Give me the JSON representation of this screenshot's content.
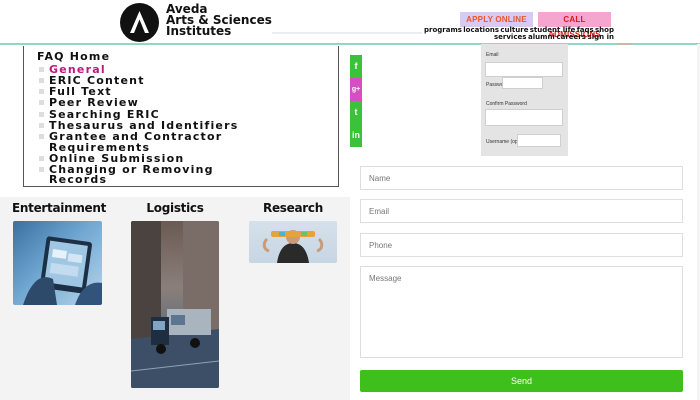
{
  "header": {
    "brand_line_1": "Aveda",
    "brand_line_2": "Arts & Sciences",
    "brand_line_3": "Institutes",
    "apply_label": "APPLY ONLINE",
    "admissions_label": "CALL ADMISSIONS",
    "nav_row_1": [
      "programs",
      "locations",
      "culture",
      "student life",
      "faqs",
      "shop"
    ],
    "nav_row_2": [
      "services",
      "alumni",
      "careers",
      "sign in"
    ],
    "colors": {
      "apply_bg": "#d9c9f5",
      "admissions_bg": "#f5a6cf",
      "rule": "#8fd9c4"
    }
  },
  "faq": {
    "home": "FAQ Home",
    "items": [
      "General",
      "ERIC Content",
      "Full Text",
      "Peer Review",
      "Searching ERIC",
      "Thesaurus and Identifiers",
      "Grantee and Contractor",
      "Requirements",
      "Online Submission",
      "Changing or Removing",
      "Records"
    ],
    "active_color": "#c0177f"
  },
  "gallery": {
    "entertainment": "Entertainment",
    "logistics": "Logistics",
    "research": "Research"
  },
  "social": {
    "icons": [
      "facebook-icon",
      "google-plus-icon",
      "twitter-icon",
      "linkedin-icon"
    ],
    "glyphs": [
      "f",
      "g+",
      "t",
      "in"
    ],
    "color": "#3cc23a"
  },
  "signup": {
    "email_label": "Email",
    "password_label": "Password",
    "confirm_label": "Confirm Password",
    "username_label": "Username (optional)"
  },
  "contact_form": {
    "name_placeholder": "Name",
    "email_placeholder": "Email",
    "phone_placeholder": "Phone",
    "message_placeholder": "Message",
    "send_label": "Send",
    "send_color": "#3fbf1c"
  }
}
